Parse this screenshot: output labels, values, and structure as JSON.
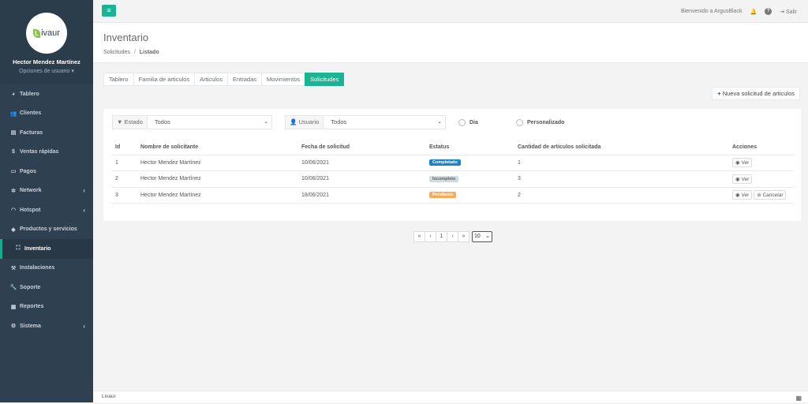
{
  "sidebar": {
    "user_name": "Hector Mendez Martínez",
    "user_options": "Opciones de usuario",
    "logo_text": "ivaur",
    "logo_letter": "L",
    "items": [
      {
        "label": "Tablero"
      },
      {
        "label": "Clientes"
      },
      {
        "label": "Facturas"
      },
      {
        "label": "Ventas rápidas"
      },
      {
        "label": "Pagos"
      },
      {
        "label": "Network"
      },
      {
        "label": "Hotspot"
      },
      {
        "label": "Productos y servicios"
      },
      {
        "label": "Inventario"
      },
      {
        "label": "Instalaciones"
      },
      {
        "label": "Soporte"
      },
      {
        "label": "Reportes"
      },
      {
        "label": "Sistema"
      }
    ]
  },
  "topbar": {
    "welcome": "Bienvenido a ArgusBlack",
    "logout": "Salir"
  },
  "page": {
    "title": "Inventario",
    "crumb_parent": "Solicitudes",
    "crumb_sep": "/",
    "crumb_current": "Listado"
  },
  "tabs": [
    {
      "label": "Tablero"
    },
    {
      "label": "Familia de articulos"
    },
    {
      "label": "Articulos"
    },
    {
      "label": "Entradas"
    },
    {
      "label": "Movimientos"
    },
    {
      "label": "Solicitudes"
    }
  ],
  "new_button": "Nueva solicitud de articulos",
  "filters": {
    "estado_label": "Estado",
    "estado_value": "Todos",
    "usuario_label": "Usuario",
    "usuario_value": "Todos",
    "radio_dia": "Dia",
    "radio_personalizado": "Personalizado"
  },
  "table": {
    "headers": [
      "Id",
      "Nombre de solicitante",
      "Fecha de solicitud",
      "Estatus",
      "Cantidad de articulos solicitada",
      "Acciones"
    ],
    "rows": [
      {
        "id": "1",
        "name": "Hector Mendez Martínez",
        "date": "10/06/2021",
        "status": "Completado",
        "status_color": "#1c84c6",
        "qty": "1"
      },
      {
        "id": "2",
        "name": "Hector Mendez Martínez",
        "date": "10/06/2021",
        "status": "Incompleto",
        "status_color": "#d1dade",
        "qty": "3"
      },
      {
        "id": "3",
        "name": "Hector Mendez Martínez",
        "date": "18/06/2021",
        "status": "Pendiente",
        "status_color": "#f8ac59",
        "qty": "2"
      }
    ],
    "view_label": "Ver",
    "cancel_label": "Cancelar"
  },
  "pager": {
    "first": "«",
    "prev": "‹",
    "page": "1",
    "next": "›",
    "last": "»",
    "per_page": "10"
  },
  "footer": {
    "text": "Livaur"
  },
  "colors": {
    "accent": "#1ab394",
    "sidebar": "#2f4050"
  }
}
